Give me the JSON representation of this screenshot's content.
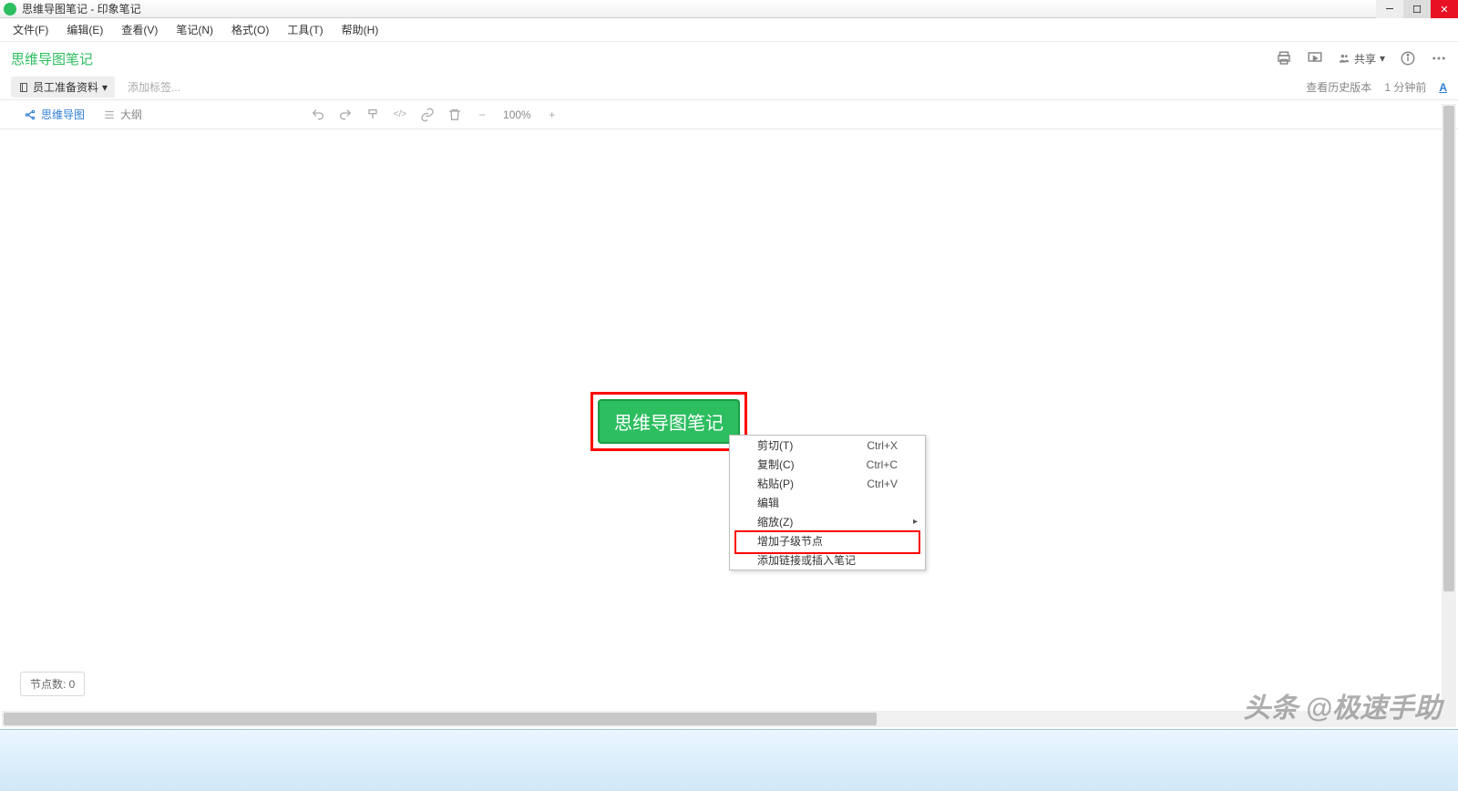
{
  "window": {
    "title": "思维导图笔记 - 印象笔记"
  },
  "menu": {
    "items": [
      "文件(F)",
      "编辑(E)",
      "查看(V)",
      "笔记(N)",
      "格式(O)",
      "工具(T)",
      "帮助(H)"
    ]
  },
  "note": {
    "title": "思维导图笔记",
    "share_label": "共享"
  },
  "notebook": {
    "selector": "员工准备资料",
    "add_tag_placeholder": "添加标签...",
    "history": "查看历史版本",
    "time": "1 分钟前",
    "format_indicator": "A"
  },
  "tabs": {
    "mindmap": "思维导图",
    "outline": "大纲"
  },
  "toolbar": {
    "zoom": "100%"
  },
  "mindnode": {
    "root_label": "思维导图笔记"
  },
  "context_menu": {
    "items": [
      {
        "label": "剪切(T)",
        "shortcut": "Ctrl+X",
        "sub": false
      },
      {
        "label": "复制(C)",
        "shortcut": "Ctrl+C",
        "sub": false
      },
      {
        "label": "粘贴(P)",
        "shortcut": "Ctrl+V",
        "sub": false
      },
      {
        "label": "编辑",
        "shortcut": "",
        "sub": false
      },
      {
        "label": "缩放(Z)",
        "shortcut": "",
        "sub": true
      },
      {
        "label": "增加子级节点",
        "shortcut": "",
        "sub": false
      },
      {
        "label": "添加链接或插入笔记",
        "shortcut": "",
        "sub": false
      }
    ]
  },
  "status": {
    "node_count_label": "节点数: 0"
  },
  "watermark": "头条 @极速手助"
}
